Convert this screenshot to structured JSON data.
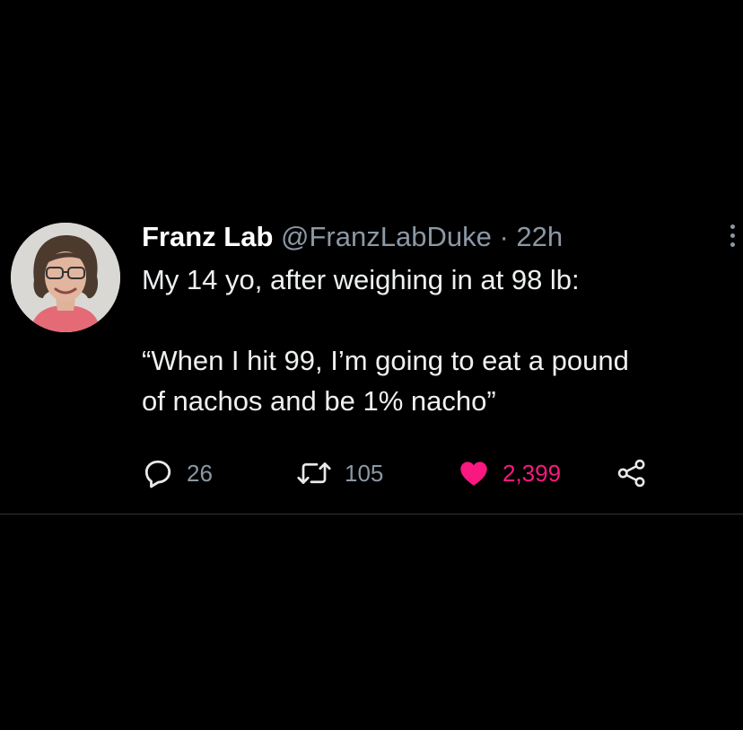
{
  "tweet": {
    "display_name": "Franz Lab",
    "handle": "@FranzLabDuke",
    "separator": "·",
    "time": "22h",
    "text_line1": "My 14 yo, after weighing in at 98 lb:",
    "text_line2": "“When I hit 99, I’m going to eat a pound",
    "text_line3": "of nachos and be 1% nacho”",
    "avatar_icon": "avatar-photo",
    "more_icon": "more-vertical-icon"
  },
  "actions": {
    "reply": {
      "icon": "reply-icon",
      "count": "26"
    },
    "retweet": {
      "icon": "retweet-icon",
      "count": "105"
    },
    "like": {
      "icon": "heart-icon",
      "count": "2,399",
      "liked": true
    },
    "share": {
      "icon": "share-icon"
    }
  },
  "colors": {
    "background": "#000000",
    "text": "#e7e9ea",
    "secondary": "#8b98a5",
    "like": "#f91880",
    "divider": "#2f3336"
  }
}
